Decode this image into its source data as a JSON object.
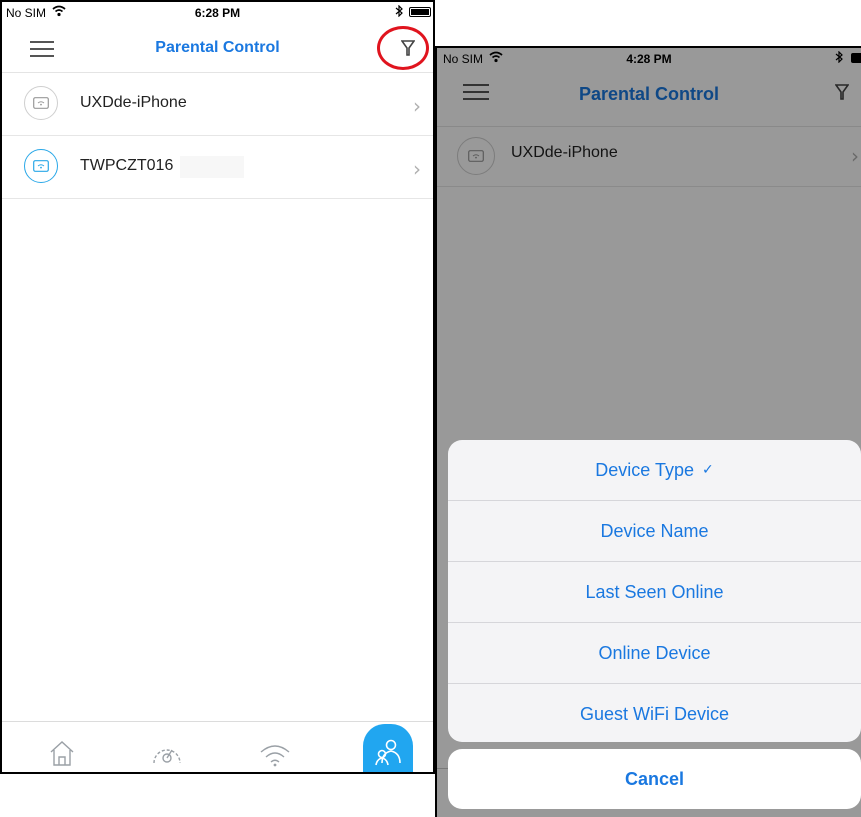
{
  "left_screen": {
    "status": {
      "carrier": "No SIM",
      "time": "6:28 PM"
    },
    "title": "Parental Control",
    "devices": [
      {
        "name": "UXDde-iPhone",
        "online": false
      },
      {
        "name": "TWPCZT016",
        "online": true
      }
    ],
    "tabs": [
      "home-icon",
      "speedometer-icon",
      "wifi-icon",
      "parental-control-icon"
    ],
    "accent": "#1a78e0",
    "highlight_color": "#e0141e"
  },
  "right_screen": {
    "status": {
      "carrier": "No SIM",
      "time": "4:28 PM"
    },
    "title": "Parental Control",
    "devices": [
      {
        "name": "UXDde-iPhone"
      }
    ],
    "sort_sheet": {
      "options": [
        {
          "label": "Device Type",
          "selected": true
        },
        {
          "label": "Device Name",
          "selected": false
        },
        {
          "label": "Last Seen Online",
          "selected": false
        },
        {
          "label": "Online Device",
          "selected": false
        },
        {
          "label": "Guest WiFi Device",
          "selected": false
        }
      ],
      "check_mark": "✓",
      "cancel_label": "Cancel"
    }
  }
}
